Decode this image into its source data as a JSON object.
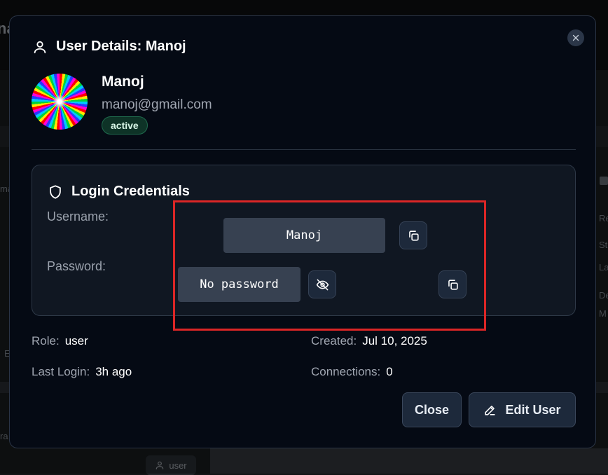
{
  "background": {
    "title_fragment": "na",
    "side_fragments": [
      "ma",
      "Re",
      "St",
      "La",
      "De",
      "M",
      "E",
      "ra"
    ],
    "chip_label": "user"
  },
  "modal": {
    "title": "User Details: Manoj",
    "title_icon": "user-icon",
    "close_icon": "close-icon"
  },
  "user": {
    "name": "Manoj",
    "email": "manoj@gmail.com",
    "status": "active",
    "avatar": "rainbow-spiral-avatar"
  },
  "credentials": {
    "title": "Login Credentials",
    "title_icon": "shield-icon",
    "username_label": "Username:",
    "username_value": "Manoj",
    "password_label": "Password:",
    "password_value": "No password",
    "copy_icon": "copy-icon",
    "visibility_icon": "eye-off-icon"
  },
  "details": {
    "role_label": "Role:",
    "role_value": "user",
    "created_label": "Created:",
    "created_value": "Jul 10, 2025",
    "last_login_label": "Last Login:",
    "last_login_value": "3h ago",
    "connections_label": "Connections:",
    "connections_value": "0"
  },
  "actions": {
    "close_label": "Close",
    "edit_label": "Edit User",
    "edit_icon": "pencil-icon"
  },
  "colors": {
    "modal_bg": "#050a14",
    "card_bg": "#101722",
    "field_bg": "#374151",
    "status_bg": "#0e3327",
    "highlight": "#dc2626"
  }
}
